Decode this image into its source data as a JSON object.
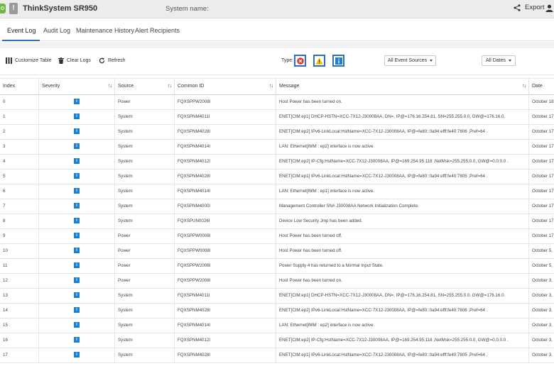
{
  "header": {
    "product": "ThinkSystem SR950",
    "system_name_label": "System name:",
    "export_label": "Export"
  },
  "tabs": [
    {
      "label": "Event Log",
      "active": true
    },
    {
      "label": "Audit Log"
    },
    {
      "label": "Maintenance History"
    },
    {
      "label": "Alert Recipients"
    }
  ],
  "toolbar": {
    "customize_label": "Customize Table",
    "clear_label": "Clear Logs",
    "refresh_label": "Refresh",
    "type_label": "Type:",
    "sources_dropdown": "All Event Sources",
    "dates_dropdown": "All Dates"
  },
  "colors": {
    "accent": "#2f6fc0",
    "info": "#1d7fcf",
    "error": "#e0322b",
    "warning": "#f2c200"
  },
  "table": {
    "columns": [
      "Index",
      "Severity",
      "Source",
      "Common ID",
      "Message",
      "Date"
    ],
    "rows": [
      {
        "index": "0",
        "severity": "info",
        "source": "Power",
        "id": "FQXSPPW2008I",
        "message": "Host Power has been turned on.",
        "date": "October 18"
      },
      {
        "index": "1",
        "severity": "info",
        "source": "System",
        "id": "FQXSPNM4011I",
        "message": "ENET[CIM:ep1] DHCP-HSTN=XCC-7X12-J30008AA, DN=, IP@=176.16.254.81, SN=255.255.0.0, GW@=176.16.0.",
        "date": "October 17"
      },
      {
        "index": "2",
        "severity": "info",
        "source": "System",
        "id": "FQXSPNM4028I",
        "message": "ENET[CIM:ep2] IPv6-LinkLocal:HstName=XCC-7X12-J30008AA, IP@=fe80::0a94:efff:fe40:7806 ,Pref=64 .",
        "date": "October 17"
      },
      {
        "index": "3",
        "severity": "info",
        "source": "System",
        "id": "FQXSPNM4014I",
        "message": "LAN: Ethernet[IMM : ep2] interface is now active.",
        "date": "October 17"
      },
      {
        "index": "4",
        "severity": "info",
        "source": "System",
        "id": "FQXSPNM4012I",
        "message": "ENET[CIM:ep2] IP-Cfg:HstName=XCC-7X12-J30008AA, IP@=169.254.95.118 ,NetMsk=255.255.0.0, GW@=0.0.0.0 .",
        "date": "October 17"
      },
      {
        "index": "5",
        "severity": "info",
        "source": "System",
        "id": "FQXSPNM4028I",
        "message": "ENET[CIM:ep1] IPv6-LinkLocal:HstName=XCC-7X12-J30008AA, IP@=fe80::0a94:efff:fe40:7805 ,Pref=64 .",
        "date": "October 17"
      },
      {
        "index": "6",
        "severity": "info",
        "source": "System",
        "id": "FQXSPNM4014I",
        "message": "LAN: Ethernet[IMM : ep1] interface is now active.",
        "date": "October 17"
      },
      {
        "index": "7",
        "severity": "info",
        "source": "System",
        "id": "FQXSPNM4000I",
        "message": "Management Controller SN# J30008AA Network Initialization Complete.",
        "date": "October 17"
      },
      {
        "index": "8",
        "severity": "info",
        "source": "System",
        "id": "FQXSPUN0026I",
        "message": "Device Low Security Jmp has been added.",
        "date": "October 17"
      },
      {
        "index": "9",
        "severity": "info",
        "source": "Power",
        "id": "FQXSPPW0008I",
        "message": "Host Power has been turned off.",
        "date": "October 17"
      },
      {
        "index": "10",
        "severity": "info",
        "source": "Power",
        "id": "FQXSPPW0008I",
        "message": "Host Power has been turned off.",
        "date": "October 5,"
      },
      {
        "index": "11",
        "severity": "info",
        "source": "Power",
        "id": "FQXSPPW2006I",
        "message": "Power Supply 4 has returned to a Normal Input State.",
        "date": "October 5,"
      },
      {
        "index": "12",
        "severity": "info",
        "source": "Power",
        "id": "FQXSPPW2008I",
        "message": "Host Power has been turned on.",
        "date": "October 3,"
      },
      {
        "index": "13",
        "severity": "info",
        "source": "System",
        "id": "FQXSPNM4011I",
        "message": "ENET[CIM:ep1] DHCP-HSTN=XCC-7X12-J30008AA, DN=, IP@=176.16.254.81, SN=255.255.0.0, GW@=176.16.0.",
        "date": "October 3,"
      },
      {
        "index": "14",
        "severity": "info",
        "source": "System",
        "id": "FQXSPNM4028I",
        "message": "ENET[CIM:ep2] IPv6-LinkLocal:HstName=XCC-7X12-J30008AA, IP@=fe80::0a94:efff:fe40:7806 ,Pref=64 .",
        "date": "October 3,"
      },
      {
        "index": "15",
        "severity": "info",
        "source": "System",
        "id": "FQXSPNM4014I",
        "message": "LAN: Ethernet[IMM : ep2] interface is now active.",
        "date": "October 3,"
      },
      {
        "index": "16",
        "severity": "info",
        "source": "System",
        "id": "FQXSPNM4012I",
        "message": "ENET[CIM:ep2] IP-Cfg:HstName=XCC-7X12-J30008AA, IP@=169.254.95.118 ,NetMsk=255.255.0.0, GW@=0.0.0.0 .",
        "date": "October 3,"
      },
      {
        "index": "17",
        "severity": "info",
        "source": "System",
        "id": "FQXSPNM4028I",
        "message": "ENET[CIM:ep1] IPv6-LinkLocal:HstName=XCC-7X12-J30008AA, IP@=fe80::0a94:efff:fe40:7805 ,Pref=64 .",
        "date": "October 3,"
      }
    ]
  }
}
